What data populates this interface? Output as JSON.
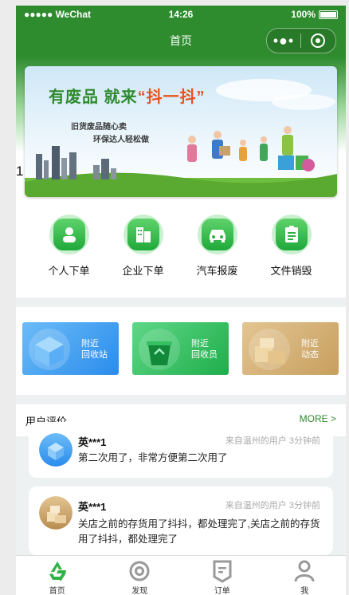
{
  "status_bar": {
    "carrier": "●●●●● WeChat",
    "time": "14:26",
    "battery": "100%"
  },
  "nav": {
    "title": "首页",
    "capsule_more": "•●•"
  },
  "banner": {
    "headline_a": "有废品  就来",
    "headline_b": "“抖一抖”",
    "sub1": "旧货废品随心卖",
    "sub2": "环保达人轻松做"
  },
  "stray_text": "1",
  "quick_actions": [
    {
      "label": "个人下单",
      "icon": "person-icon"
    },
    {
      "label": "企业下单",
      "icon": "building-icon"
    },
    {
      "label": "汽车报废",
      "icon": "car-icon"
    },
    {
      "label": "文件销毁",
      "icon": "document-icon"
    }
  ],
  "nearby_cards": [
    {
      "line1": "附近",
      "line2": "回收站",
      "color_a": "#4ea8f4",
      "color_b": "#1f86ea"
    },
    {
      "line1": "附近",
      "line2": "回收员",
      "color_a": "#4ed07a",
      "color_b": "#1fae4b"
    },
    {
      "line1": "附近",
      "line2": "动态",
      "color_a": "#dcbb86",
      "color_b": "#c79f5f"
    }
  ],
  "reviews_section": {
    "title": "用户评价",
    "more": "MORE >"
  },
  "reviews": [
    {
      "name": "英***1",
      "meta": "来自温州的用户 3分钟前",
      "text": "第二次用了，非常方便第二次用了"
    },
    {
      "name": "英***1",
      "meta": "来自温州的用户 3分钟前",
      "text": "关店之前的存货用了抖抖，都处理完了,关店之前的存货用了抖抖，都处理完了"
    }
  ],
  "tabs": [
    {
      "label": "首页",
      "icon": "recycle-icon",
      "active": true
    },
    {
      "label": "发现",
      "icon": "compass-icon",
      "active": false
    },
    {
      "label": "订单",
      "icon": "order-icon",
      "active": false
    },
    {
      "label": "我",
      "icon": "user-icon",
      "active": false
    }
  ],
  "colors": {
    "brand": "#2e8b2e",
    "accent": "#e8531f"
  }
}
